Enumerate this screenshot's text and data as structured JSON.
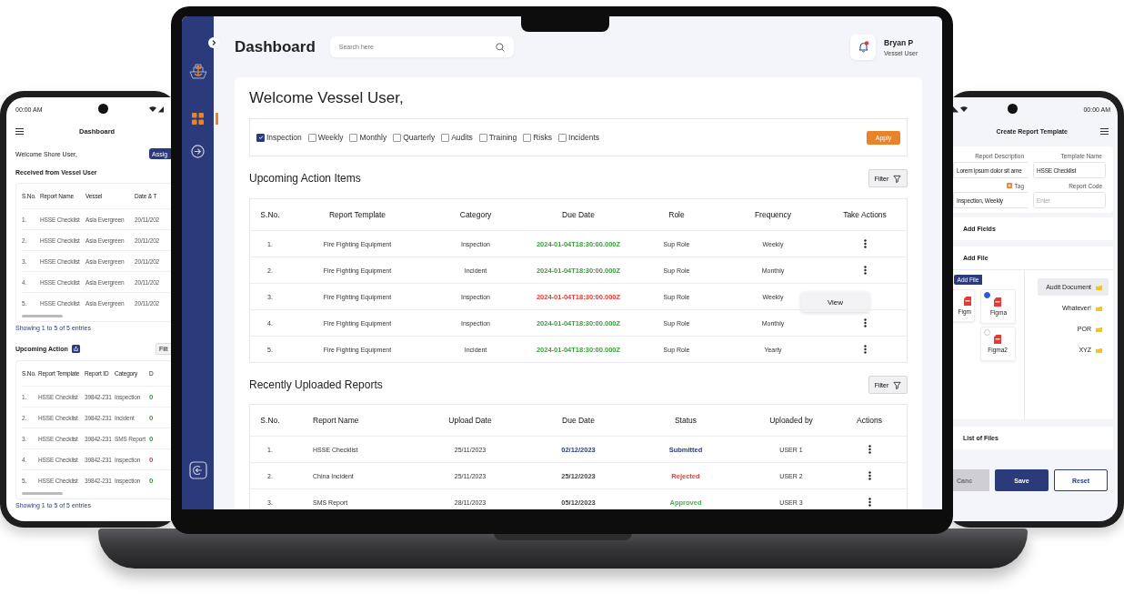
{
  "phone_left": {
    "time": "00:00 AM",
    "title": "Dashboard",
    "welcome": "Welcome Shore User,",
    "assign_button": "Assig",
    "received": {
      "title": "Received from Vessel User",
      "columns": [
        "S.No.",
        "Report Name",
        "Vessel",
        "Date & T"
      ],
      "rows": [
        [
          "1.",
          "HSSE Checklist",
          "Asia Evergreen",
          "20/11/202"
        ],
        [
          "2.",
          "HSSE Checklist",
          "Asia Evergreen",
          "20/11/202"
        ],
        [
          "3.",
          "HSSE Checklist",
          "Asia Evergreen",
          "20/11/202"
        ],
        [
          "4.",
          "HSSE Checklist",
          "Asia Evergreen",
          "20/11/202"
        ],
        [
          "5.",
          "HSSE Checklist",
          "Asia Evergreen",
          "20/11/202"
        ]
      ],
      "footer": "Showing 1 to 5 of 5 entries"
    },
    "upcoming": {
      "title": "Upcoming Action",
      "filter_button": "Filt",
      "columns": [
        "S.No.",
        "Report Template",
        "Report ID",
        "Category",
        "D"
      ],
      "rows": [
        {
          "cells": [
            "1.",
            "HSSE Checklist",
            "39842-231",
            "Inspection"
          ],
          "due": {
            "text": "0",
            "color": "#3d9b3d"
          }
        },
        {
          "cells": [
            "2.",
            "HSSE Checklist",
            "39842-231",
            "Incident"
          ],
          "due": {
            "text": "0",
            "color": "#3d9b3d"
          }
        },
        {
          "cells": [
            "3.",
            "HSSE Checklist",
            "39842-231",
            "SMS Report"
          ],
          "due": {
            "text": "0",
            "color": "#3d9b3d"
          }
        },
        {
          "cells": [
            "4.",
            "HSSE Checklist",
            "39842-231",
            "Inspection"
          ],
          "due": {
            "text": "0",
            "color": "#e53935"
          }
        },
        {
          "cells": [
            "5.",
            "HSSE Checklist",
            "39842-231",
            "Inspection"
          ],
          "due": {
            "text": "0",
            "color": "#3d9b3d"
          }
        }
      ],
      "footer": "Showing 1 to 5 of 5 entries"
    }
  },
  "laptop": {
    "nav_items": [
      {
        "kind": "grid",
        "selected": true
      },
      {
        "kind": "enter",
        "selected": false
      },
      {
        "kind": "logout",
        "selected": false
      }
    ],
    "title": "Dashboard",
    "search": {
      "placeholder": "Search here"
    },
    "user": {
      "name": "Bryan P",
      "role": "Vessel User"
    },
    "welcome": "Welcome Vessel User,",
    "filters": [
      {
        "label": "Inspection",
        "checked": true
      },
      {
        "label": "Weekly",
        "checked": false
      },
      {
        "label": "Monthly",
        "checked": false
      },
      {
        "label": "Quarterly",
        "checked": false
      },
      {
        "label": "Audits",
        "checked": false
      },
      {
        "label": "Training",
        "checked": false
      },
      {
        "label": "Risks",
        "checked": false
      },
      {
        "label": "Incidents",
        "checked": false
      }
    ],
    "apply_button": "Apply",
    "upcoming": {
      "title": "Upcoming Action Items",
      "filter_button": "Filter",
      "menu_item": "View",
      "columns": [
        "S.No.",
        "Report Template",
        "Category",
        "Due Date",
        "Role",
        "Frequency",
        "Take Actions"
      ],
      "rows": [
        {
          "sno": "1.",
          "template": "Fire Fighting Equipment",
          "category": "Inspection",
          "due": {
            "text": "2024-01-04T18:30:00.000Z",
            "color": "#3d9b3d"
          },
          "role": "Sup Role",
          "frequency": "Weekly",
          "menu_open": false
        },
        {
          "sno": "2.",
          "template": "Fire Fighting Equipment",
          "category": "Incident",
          "due": {
            "text": "2024-01-04T18:30:00.000Z",
            "color": "#3d9b3d"
          },
          "role": "Sup Role",
          "frequency": "Monthly",
          "menu_open": false
        },
        {
          "sno": "3.",
          "template": "Fire Fighting Equipment",
          "category": "Inspection",
          "due": {
            "text": "2024-01-04T18:30:00.000Z",
            "color": "#e53935"
          },
          "role": "Sup Role",
          "frequency": "Weekly",
          "menu_open": true
        },
        {
          "sno": "4.",
          "template": "Fire Fighting Equipment",
          "category": "Inspection",
          "due": {
            "text": "2024-01-04T18:30:00.000Z",
            "color": "#3d9b3d"
          },
          "role": "Sup Role",
          "frequency": "Monthly",
          "menu_open": false
        },
        {
          "sno": "5.",
          "template": "Fire Fighting Equipment",
          "category": "Incident",
          "due": {
            "text": "2024-01-04T18:30:00.000Z",
            "color": "#3d9b3d"
          },
          "role": "Sup Role",
          "frequency": "Yearly",
          "menu_open": false
        }
      ]
    },
    "recent": {
      "title": "Recently Uploaded Reports",
      "filter_button": "Filter",
      "columns": [
        "S.No.",
        "Report Name",
        "Upload Date",
        "Due Date",
        "Status",
        "Uploaded by",
        "Actions"
      ],
      "rows": [
        {
          "sno": "1.",
          "name": "HSSE Checklist",
          "uploaded": "25/11/2023",
          "due": {
            "text": "02/12/2023",
            "color": "#2c3a7c"
          },
          "status": {
            "text": "Submitted",
            "color": "#2c3a7c"
          },
          "user": "USER 1"
        },
        {
          "sno": "2.",
          "name": "China Incident",
          "uploaded": "25/11/2023",
          "due": {
            "text": "25/12/2023",
            "color": "#444444"
          },
          "status": {
            "text": "Rejected",
            "color": "#e53935"
          },
          "user": "USER 2"
        },
        {
          "sno": "3.",
          "name": "SMS Report",
          "uploaded": "28/11/2023",
          "due": {
            "text": "05/12/2023",
            "color": "#444444"
          },
          "status": {
            "text": "Approved",
            "color": "#4caf50"
          },
          "user": "USER 3"
        }
      ]
    }
  },
  "phone_right": {
    "time": "00:00 AM",
    "title": "Create Report Template",
    "fields": [
      {
        "label": "Report Description",
        "value": "Lorem ipsum dolor sit ame"
      },
      {
        "label": "Template Name",
        "value": "HSSE Checklist"
      },
      {
        "label": "Tag",
        "value": "Inspection, Weekly",
        "kind": "tag"
      },
      {
        "label": "Report Code",
        "placeholder": "Enter"
      }
    ],
    "add_fields": "Add Fields",
    "add_file": "Add File",
    "folders": [
      {
        "name": "Audit Document",
        "selected": true
      },
      {
        "name": "Whatever!",
        "selected": false
      },
      {
        "name": "POR",
        "selected": false
      },
      {
        "name": "XYZ",
        "selected": false
      }
    ],
    "add_file_button": "Add File",
    "files": [
      {
        "name": "Figm"
      },
      {
        "name": "Figma",
        "checked": true
      },
      {
        "name": "Figma2",
        "checked": false
      }
    ],
    "list_of_files": "List of Files",
    "buttons": [
      {
        "label": "Canc",
        "kind": "disabled"
      },
      {
        "label": "Save",
        "kind": "primary"
      },
      {
        "label": "Reset",
        "kind": "outline"
      }
    ]
  }
}
